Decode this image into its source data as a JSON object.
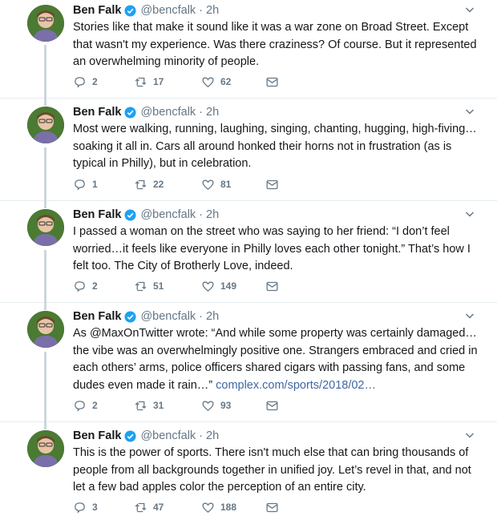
{
  "author": {
    "name": "Ben Falk",
    "handle": "@bencfalk",
    "separator": "·",
    "time": "2h"
  },
  "tweets": [
    {
      "text": "Stories like that make it sound like it was a war zone on Broad Street. Except that wasn't my experience. Was there craziness? Of course. But it represented an overwhelming minority of people.",
      "replies": "2",
      "retweets": "17",
      "likes": "62"
    },
    {
      "text": "Most were walking, running, laughing, singing, chanting, hugging, high-fiving… soaking it all in. Cars all around honked their horns not in frustration (as is typical in Philly), but in celebration.",
      "replies": "1",
      "retweets": "22",
      "likes": "81"
    },
    {
      "text": "I passed a woman on the street who was saying to her friend: “I don’t feel worried…it feels like everyone in Philly loves each other tonight.” That’s how I felt too. The City of Brotherly Love, indeed.",
      "replies": "2",
      "retweets": "51",
      "likes": "149"
    },
    {
      "text_before": "As @MaxOnTwitter wrote: “And while some property was certainly damaged… the vibe was an overwhelmingly positive one. Strangers embraced and cried in each others’ arms, police officers shared cigars with passing fans, and some dudes even made it rain…” ",
      "link": "complex.com/sports/2018/02…",
      "replies": "2",
      "retweets": "31",
      "likes": "93"
    },
    {
      "text": "This is the power of sports. There isn't much else that can bring thousands of people from all backgrounds together in unified joy. Let’s revel in that, and not let a few bad apples color the perception of an entire city.",
      "replies": "3",
      "retweets": "47",
      "likes": "188"
    }
  ],
  "colors": {
    "text": "#14171a",
    "muted": "#657786",
    "verified": "#1da1f2",
    "divider": "#e6ecf0",
    "thread_line": "#ccd6dd"
  },
  "icons": [
    "reply-icon",
    "retweet-icon",
    "like-icon",
    "dm-icon",
    "verified-badge-icon",
    "caret-down-icon"
  ]
}
